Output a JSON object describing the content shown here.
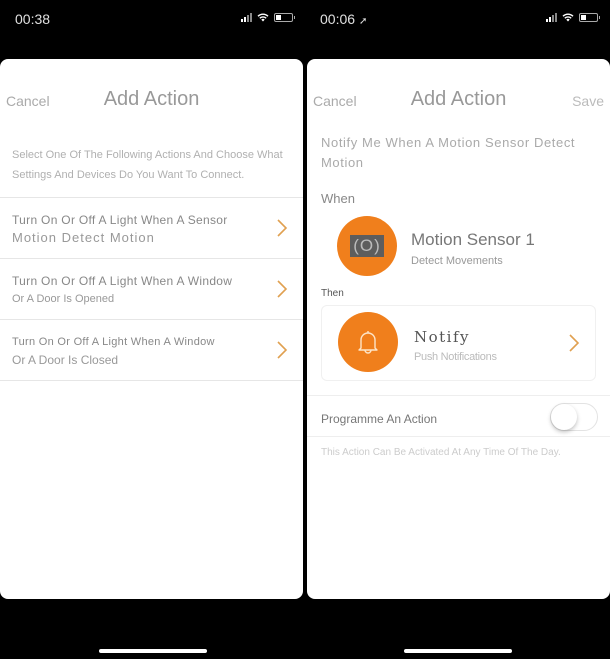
{
  "left": {
    "status": {
      "time": "00:38"
    },
    "nav": {
      "cancel": "Cancel",
      "title": "Add Action"
    },
    "intro": "Select One Of The Following Actions And Choose What Settings And Devices Do You Want To Connect.",
    "actions": [
      {
        "line1": "Turn On Or Off A Light When A Sensor",
        "line2": "Motion Detect Motion"
      },
      {
        "line1": "Turn On Or Off A Light When A Window",
        "line2": "Or A Door Is Opened"
      },
      {
        "line1": "Turn On Or Off A Light When A Window",
        "line2": "Or A Door Is Closed"
      }
    ]
  },
  "right": {
    "status": {
      "time": "00:06"
    },
    "nav": {
      "cancel": "Cancel",
      "title": "Add Action",
      "save": "Save"
    },
    "heading": "Notify Me When A Motion Sensor Detect Motion",
    "when": {
      "label": "When",
      "icon_text": "(O)",
      "device_name": "Motion Sensor 1",
      "device_sub": "Detect Movements"
    },
    "then": {
      "label": "Then",
      "name": "Notify",
      "sub": "Push Notifications"
    },
    "schedule": {
      "label": "Programme An Action",
      "enabled": false,
      "footnote": "This Action Can Be Activated At Any Time Of The Day."
    }
  },
  "colors": {
    "accent": "#f07f1c",
    "chevron": "#e0a050"
  }
}
